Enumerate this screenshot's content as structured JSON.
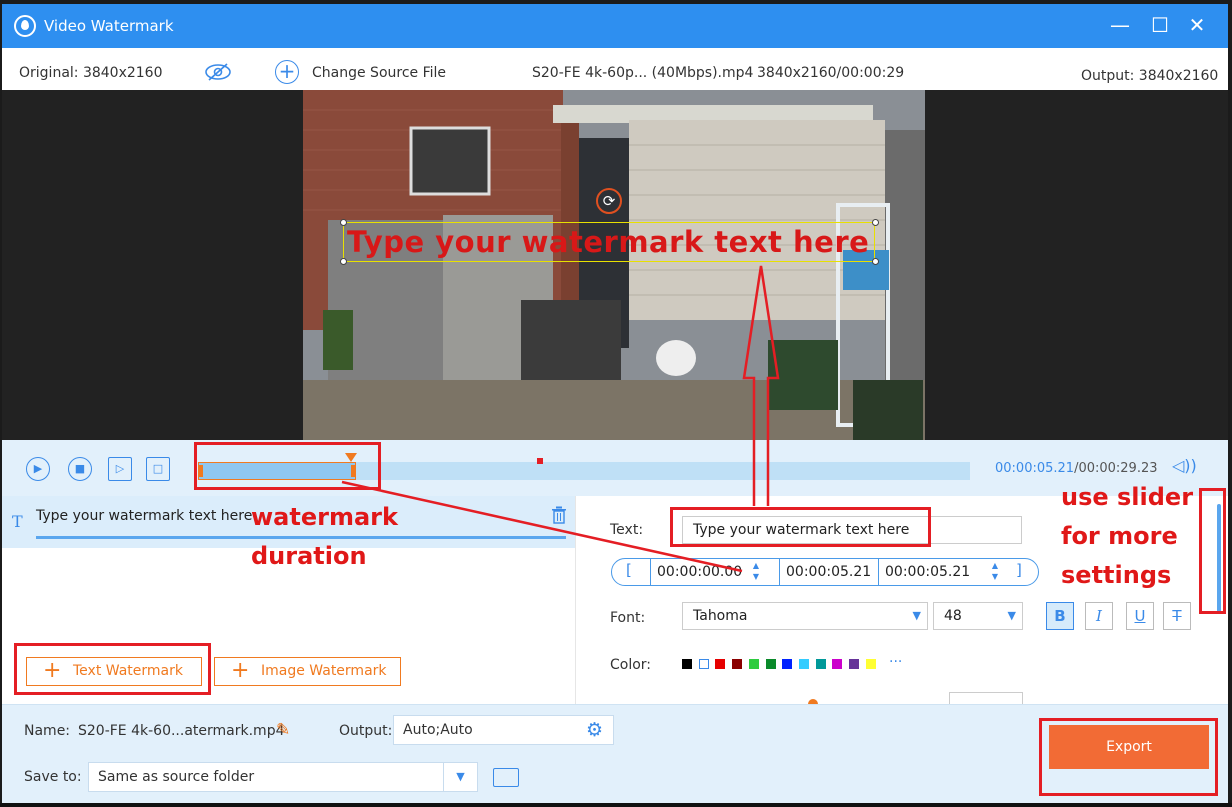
{
  "window": {
    "title": "Video Watermark",
    "controls": {
      "minimize": "—",
      "maximize": "☐",
      "close": "✕"
    }
  },
  "info": {
    "original": "Original: 3840x2160",
    "change_source": "Change Source File",
    "filename": "S20-FE 4k-60p... (40Mbps).mp4",
    "resolution_duration": "3840x2160/00:00:29",
    "output": "Output: 3840x2160"
  },
  "preview": {
    "overlay_text": "Type your watermark text here",
    "rotate_icon": "⟳"
  },
  "controls": {
    "play_icon": "▶",
    "stop_icon": "■",
    "next_icon": "▷",
    "fullscreen_icon": "□",
    "current_time": "00:00:05.21",
    "total_time": "/00:00:29.23",
    "volume_icon": "🔊"
  },
  "watermark_list": {
    "item_icon": "T",
    "item_label": "Type your watermark text here",
    "trash_icon": "🗑",
    "add_text": "Text Watermark",
    "add_image": "Image Watermark",
    "plus": "+"
  },
  "settings": {
    "text_label": "Text:",
    "text_value": "Type your watermark text here",
    "start_bracket": "[",
    "end_bracket": "]",
    "start_time": "00:00:00.00",
    "duration": "00:00:05.21",
    "end_time": "00:00:05.21",
    "font_label": "Font:",
    "font_value": "Tahoma",
    "size_value": "48",
    "bold": "B",
    "italic": "I",
    "underline": "U",
    "strike": "T",
    "color_label": "Color:",
    "more_colors": "···",
    "colors": [
      "#000000",
      "#ffffff",
      "#e60000",
      "#8b0000",
      "#2ecc40",
      "#0a8a2a",
      "#0022ff",
      "#33ccff",
      "#009999",
      "#cc00cc",
      "#663399",
      "#ffff33"
    ]
  },
  "bottom": {
    "name_label": "Name:",
    "name_value": "S20-FE 4k-60...atermark.mp4",
    "output_label": "Output:",
    "output_value": "Auto;Auto",
    "save_label": "Save to:",
    "save_value": "Same as source folder",
    "export": "Export",
    "edit_icon": "✎",
    "gear_icon": "⚙",
    "folder_icon": "▭",
    "dropdown_icon": "▼"
  },
  "annotations": {
    "duration_line1": "watermark",
    "duration_line2": "duration",
    "slider_line1": "use slider",
    "slider_line2": "for more",
    "slider_line3": "settings"
  }
}
